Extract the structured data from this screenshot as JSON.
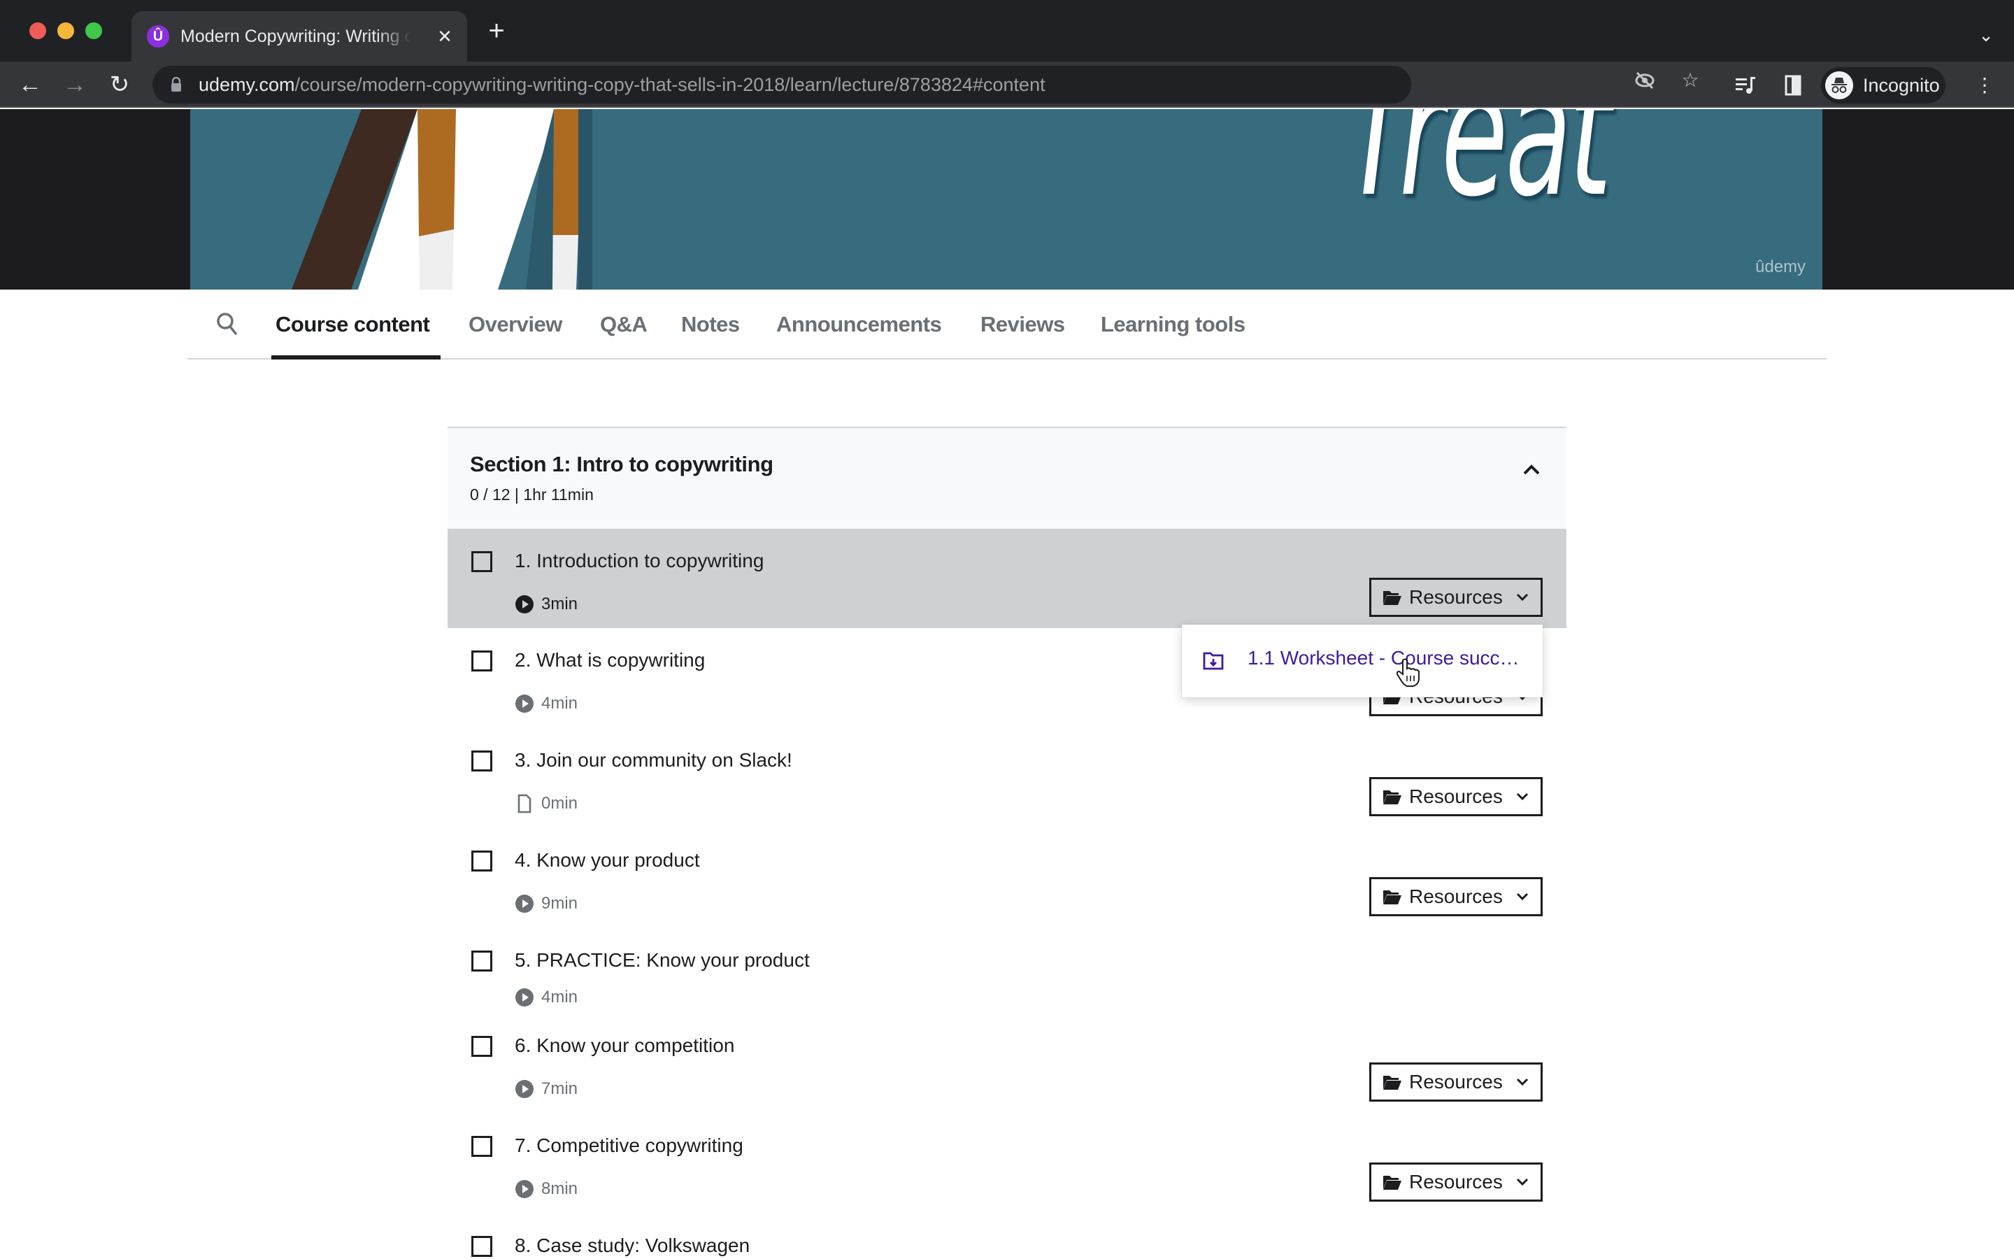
{
  "browser": {
    "tab_title": "Modern Copywriting: Writing copy that sells",
    "tab_favicon_letter": "Û",
    "url_host": "udemy.com",
    "url_path": "/course/modern-copywriting-writing-copy-that-sells-in-2018/learn/lecture/8783824#content",
    "profile_label": "Incognito"
  },
  "video": {
    "overlay_word": "Treat",
    "watermark": "ûdemy"
  },
  "course_nav": {
    "tabs": [
      {
        "label": "Course content",
        "active": true
      },
      {
        "label": "Overview",
        "active": false
      },
      {
        "label": "Q&A",
        "active": false
      },
      {
        "label": "Notes",
        "active": false
      },
      {
        "label": "Announcements",
        "active": false
      },
      {
        "label": "Reviews",
        "active": false
      },
      {
        "label": "Learning tools",
        "active": false
      }
    ]
  },
  "section": {
    "title": "Section 1: Intro to copywriting",
    "meta": "0 / 12 | 1hr 11min",
    "expanded": true
  },
  "lectures": [
    {
      "title": "1. Introduction to copywriting",
      "duration": "3min",
      "type": "video",
      "checked": false,
      "current": true,
      "has_resources": true
    },
    {
      "title": "2. What is copywriting",
      "duration": "4min",
      "type": "video",
      "checked": false,
      "current": false,
      "has_resources": true
    },
    {
      "title": "3. Join our community on Slack!",
      "duration": "0min",
      "type": "article",
      "checked": false,
      "current": false,
      "has_resources": true
    },
    {
      "title": "4. Know your product",
      "duration": "9min",
      "type": "video",
      "checked": false,
      "current": false,
      "has_resources": true
    },
    {
      "title": "5. PRACTICE: Know your product",
      "duration": "4min",
      "type": "video",
      "checked": false,
      "current": false,
      "has_resources": false
    },
    {
      "title": "6. Know your competition",
      "duration": "7min",
      "type": "video",
      "checked": false,
      "current": false,
      "has_resources": true
    },
    {
      "title": "7. Competitive copywriting",
      "duration": "8min",
      "type": "video",
      "checked": false,
      "current": false,
      "has_resources": true
    },
    {
      "title": "8. Case study: Volkswagen",
      "duration": "",
      "type": "video",
      "checked": false,
      "current": false,
      "has_resources": false
    }
  ],
  "resources_label": "Resources",
  "resources_dropdown": {
    "items": [
      {
        "label": "1.1 Worksheet - Course succ…",
        "icon": "folder-download-icon"
      }
    ]
  },
  "colors": {
    "accent_link": "#401b9c",
    "current_row_bg": "#cdd1d4",
    "banner_teal": "#376b7e"
  }
}
